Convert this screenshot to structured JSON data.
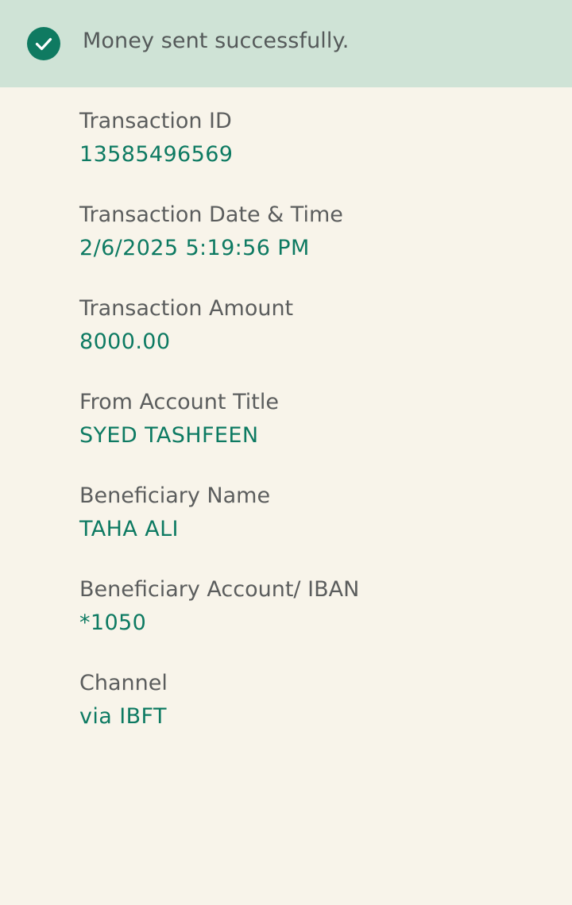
{
  "banner": {
    "message": "Money sent successfully.",
    "icon": "check-circle-icon",
    "accent": "#0f7a61",
    "background": "#cfe3d6"
  },
  "details": [
    {
      "label": "Transaction ID",
      "value": "13585496569"
    },
    {
      "label": "Transaction Date & Time",
      "value": "2/6/2025 5:19:56 PM"
    },
    {
      "label": "Transaction Amount",
      "value": "8000.00"
    },
    {
      "label": "From Account Title",
      "value": "SYED TASHFEEN"
    },
    {
      "label": "Beneficiary Name",
      "value": "TAHA ALI"
    },
    {
      "label": "Beneficiary Account/ IBAN",
      "value": "*1050"
    },
    {
      "label": "Channel",
      "value": "via IBFT"
    }
  ],
  "colors": {
    "page_background": "#f8f4ea",
    "label_text": "#5b5d5d",
    "value_text": "#0d7a62"
  }
}
